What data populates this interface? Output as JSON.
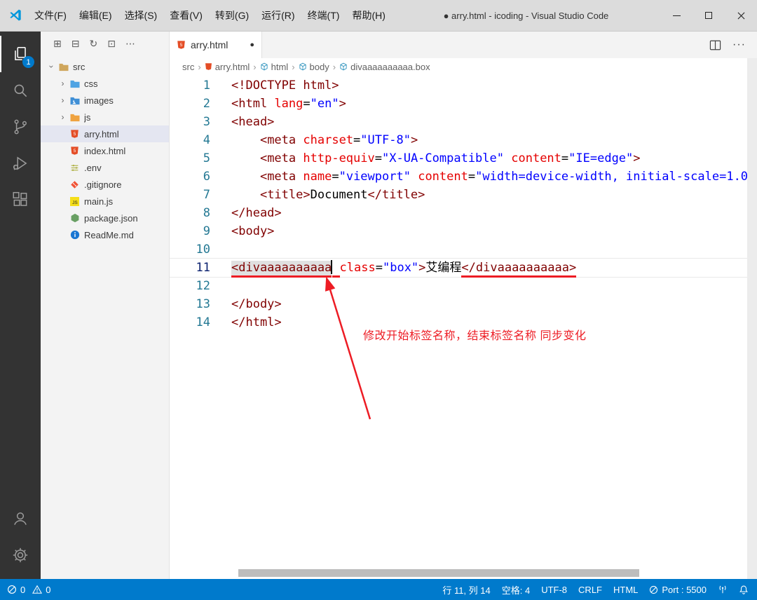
{
  "window": {
    "title": "● arry.html - icoding - Visual Studio Code",
    "menus": [
      "文件(F)",
      "编辑(E)",
      "选择(S)",
      "查看(V)",
      "转到(G)",
      "运行(R)",
      "终端(T)",
      "帮助(H)"
    ]
  },
  "activity_bar": {
    "explorer_badge": "1"
  },
  "sidebar": {
    "header_icons": [
      "⊞",
      "⊟",
      "↻",
      "⊡",
      "⋯"
    ],
    "tree": [
      {
        "label": "src",
        "kind": "folder",
        "state": "expanded",
        "level": 0
      },
      {
        "label": "css",
        "kind": "folder",
        "state": "collapsed",
        "level": 1
      },
      {
        "label": "images",
        "kind": "folder",
        "state": "collapsed",
        "level": 1
      },
      {
        "label": "js",
        "kind": "folder",
        "state": "collapsed",
        "level": 1
      },
      {
        "label": "arry.html",
        "kind": "html",
        "level": 1,
        "selected": true
      },
      {
        "label": "index.html",
        "kind": "html",
        "level": 1
      },
      {
        "label": ".env",
        "kind": "env",
        "level": 0
      },
      {
        "label": ".gitignore",
        "kind": "git",
        "level": 0
      },
      {
        "label": "main.js",
        "kind": "js",
        "level": 0
      },
      {
        "label": "package.json",
        "kind": "node",
        "level": 0
      },
      {
        "label": "ReadMe.md",
        "kind": "info",
        "level": 0
      }
    ]
  },
  "editor": {
    "tab": {
      "label": "arry.html",
      "dirty": "●"
    },
    "breadcrumb": [
      {
        "label": "src"
      },
      {
        "label": "arry.html"
      },
      {
        "label": "html"
      },
      {
        "label": "body"
      },
      {
        "label": "divaaaaaaaaaa.box"
      }
    ],
    "annotation": {
      "text": "修改开始标签名称，结束标签名称 同步变化"
    },
    "lines": [
      {
        "n": "1",
        "t": [
          [
            "tag",
            "<!DOCTYPE html>"
          ]
        ]
      },
      {
        "n": "2",
        "t": [
          [
            "tag",
            "<html"
          ],
          [
            "pln",
            " "
          ],
          [
            "attr",
            "lang"
          ],
          [
            "pln",
            "="
          ],
          [
            "val",
            "\"en\""
          ],
          [
            "tag",
            ">"
          ]
        ]
      },
      {
        "n": "3",
        "t": [
          [
            "tag",
            "<head>"
          ]
        ]
      },
      {
        "n": "4",
        "t": [
          [
            "pln",
            "    "
          ],
          [
            "tag",
            "<meta"
          ],
          [
            "pln",
            " "
          ],
          [
            "attr",
            "charset"
          ],
          [
            "pln",
            "="
          ],
          [
            "val",
            "\"UTF-8\""
          ],
          [
            "tag",
            ">"
          ]
        ]
      },
      {
        "n": "5",
        "t": [
          [
            "pln",
            "    "
          ],
          [
            "tag",
            "<meta"
          ],
          [
            "pln",
            " "
          ],
          [
            "attr",
            "http-equiv"
          ],
          [
            "pln",
            "="
          ],
          [
            "val",
            "\"X-UA-Compatible\""
          ],
          [
            "pln",
            " "
          ],
          [
            "attr",
            "content"
          ],
          [
            "pln",
            "="
          ],
          [
            "val",
            "\"IE=edge\""
          ],
          [
            "tag",
            ">"
          ]
        ]
      },
      {
        "n": "6",
        "t": [
          [
            "pln",
            "    "
          ],
          [
            "tag",
            "<meta"
          ],
          [
            "pln",
            " "
          ],
          [
            "attr",
            "name"
          ],
          [
            "pln",
            "="
          ],
          [
            "val",
            "\"viewport\""
          ],
          [
            "pln",
            " "
          ],
          [
            "attr",
            "content"
          ],
          [
            "pln",
            "="
          ],
          [
            "val",
            "\"width=device-width, initial-scale=1.0\""
          ],
          [
            "tag",
            ">"
          ]
        ]
      },
      {
        "n": "7",
        "t": [
          [
            "pln",
            "    "
          ],
          [
            "tag",
            "<title>"
          ],
          [
            "txt",
            "Document"
          ],
          [
            "tag",
            "</title>"
          ]
        ]
      },
      {
        "n": "8",
        "t": [
          [
            "tag",
            "</head>"
          ]
        ]
      },
      {
        "n": "9",
        "t": [
          [
            "tag",
            "<body>"
          ]
        ]
      },
      {
        "n": "10",
        "t": []
      },
      {
        "n": "11",
        "active": true,
        "t": [
          [
            "tag",
            "<divaaaaaaaaaa",
            "mu"
          ],
          [
            "cur",
            ""
          ],
          [
            "pln",
            " ",
            "u"
          ],
          [
            "attr",
            "class"
          ],
          [
            "pln",
            "="
          ],
          [
            "val",
            "\"box\""
          ],
          [
            "tag",
            ">"
          ],
          [
            "txt",
            "艾编程"
          ],
          [
            "tag",
            "</divaaaaaaaaaa>",
            "u"
          ]
        ]
      },
      {
        "n": "12",
        "t": []
      },
      {
        "n": "13",
        "t": [
          [
            "tag",
            "</body>"
          ]
        ]
      },
      {
        "n": "14",
        "t": [
          [
            "tag",
            "</html>"
          ]
        ]
      }
    ]
  },
  "status_bar": {
    "errors": "0",
    "warnings": "0",
    "cursor": "行 11, 列 14",
    "indent": "空格: 4",
    "encoding": "UTF-8",
    "eol": "CRLF",
    "language": "HTML",
    "port": "Port : 5500"
  },
  "icons": {
    "chevron": "›",
    "more": "···",
    "html_badge": "5",
    "js_badge": "JS"
  },
  "colors": {
    "accent": "#007acc",
    "annotation_red": "#ed1c24",
    "tag": "#800000",
    "attribute": "#e50000",
    "value": "#0000ff",
    "line_number": "#237893"
  }
}
